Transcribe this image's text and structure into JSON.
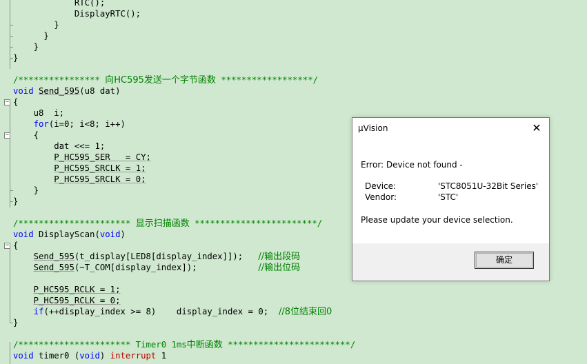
{
  "code": {
    "l01": "RTC();",
    "l02": "DisplayRTC();",
    "l03": "}",
    "l04": "}",
    "l05": "}",
    "l06": "}",
    "c_send_comment_a": "/**************** ",
    "c_send_comment_cn": "向HC595发送一个字节函数",
    "c_send_comment_b": " ******************/",
    "send_void": "void",
    "send_name": "Send_595",
    "send_params": "(u8 dat)",
    "send_open": "{",
    "send_decl": "u8  i;",
    "for_kw": "for",
    "for_rest": "(i=0; i<8; i++)",
    "for_open": "{",
    "dat_line": "dat <<= 1;",
    "ser_line": "P_HC595_SER   = CY;",
    "srclk1_line": "P_HC595_SRCLK = 1;",
    "srclk0_line": "P_HC595_SRCLK = 0;",
    "for_close": "}",
    "send_close": "}",
    "scan_comment_a": "/********************** ",
    "scan_comment_cn": "显示扫描函数",
    "scan_comment_b": " ************************/",
    "scan_void": "void",
    "scan_name": " DisplayScan(",
    "scan_void2": "void",
    "scan_end": ")",
    "scan_open": "{",
    "scan_l1_call": "Send_595",
    "scan_l1_rest": "(t_display[LED8[display_index]]);   ",
    "scan_l1_cm": "//输出段码",
    "scan_l2_call": "Send_595",
    "scan_l2_rest": "(~T_COM[display_index]);            ",
    "scan_l2_cm": "//输出位码",
    "rclk1": "P_HC595_RCLK = 1;",
    "rclk0": "P_HC595_RCLK = 0;",
    "if_kw": "if",
    "if_rest": "(++display_index >= 8)    display_index = 0;  ",
    "if_cm": "//8位结束回0",
    "scan_close": "}",
    "timer_comment_a": "/********************** Timer0 1ms",
    "timer_comment_cn": "中断函数",
    "timer_comment_b": " ************************/",
    "timer_void": "void",
    "timer_mid": " timer0 (",
    "timer_void2": "void",
    "timer_end": ") ",
    "timer_interrupt": "interrupt",
    "timer_num": " 1"
  },
  "dialog": {
    "title": "µVision",
    "close_glyph": "✕",
    "error": "Error: Device not found -",
    "device_label": "Device:",
    "device_value": "'STC8051U-32Bit Series'",
    "vendor_label": "Vendor:",
    "vendor_value": "'STC'",
    "message": "Please update your device selection.",
    "ok_label": "确定"
  }
}
